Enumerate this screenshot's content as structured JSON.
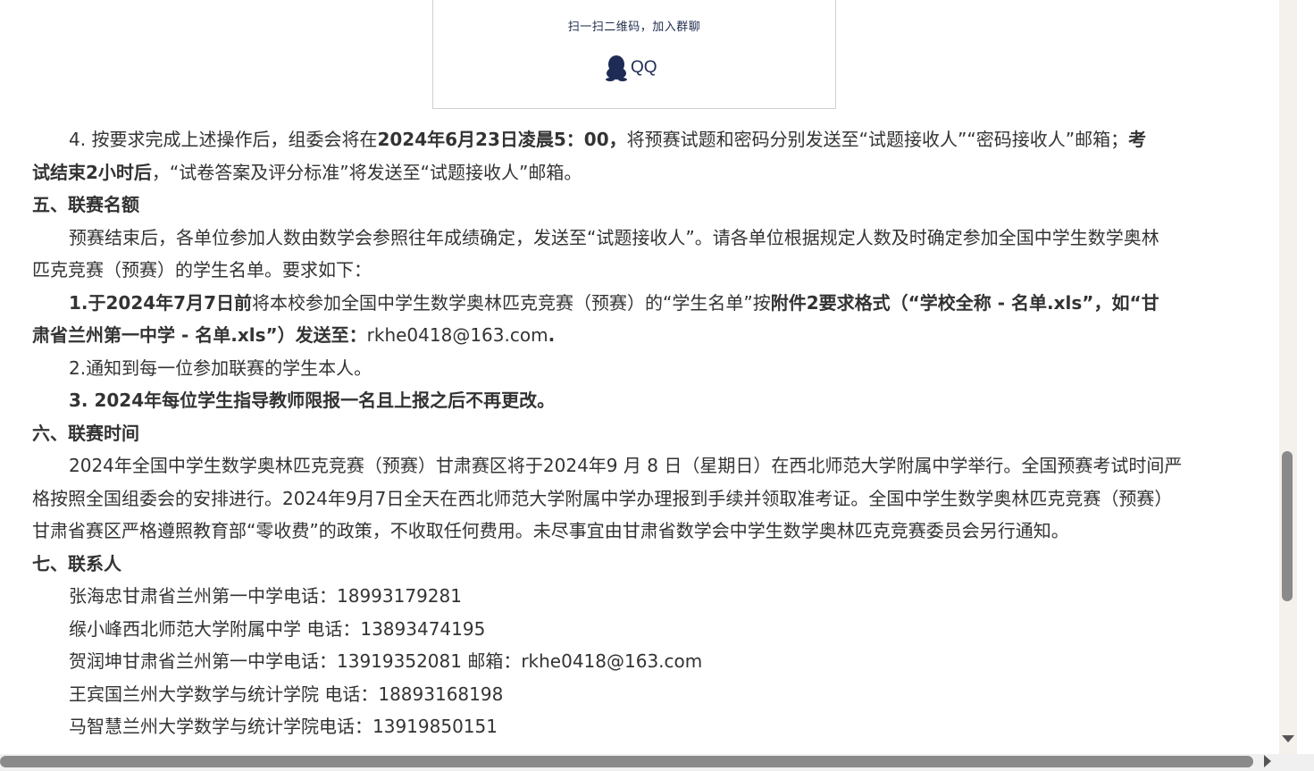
{
  "qr_card": {
    "caption": "扫一扫二维码，加入群聊",
    "qq_label": "QQ",
    "icon": "qq-penguin-icon"
  },
  "article": {
    "p1": {
      "a": "4. 按要求完成上述操作后，组委会将在",
      "b": "2024年6月23日凌晨5：00，",
      "c": "将预赛试题和密码分别发送至“试题接收人”“密码接收人”邮箱；",
      "d": "考",
      "e": "试结束2小时后",
      "f": "，“试卷答案及评分标准”将发送至“试题接收人”邮箱。"
    },
    "h5": "五、联赛名额",
    "p2_line1": "预赛结束后，各单位参加人数由数学会参照往年成绩确定，发送至“试题接收人”。请各单位根据规定人数及时确定参加全国中学生数学奥林",
    "p2_line2": "匹克竞赛（预赛）的学生名单。要求如下：",
    "p3": {
      "a": "1.于2024年7月7日前",
      "b": "将本校参加全国中学生数学奥林匹克竞赛（预赛）的“学生名单”按",
      "c": "附件2要求格式（“学校全称 - 名单.xls”，如“甘",
      "d": "肃省兰州第一中学 - 名单.xls”）发送至：",
      "e": "rkhe0418@163.com",
      "f": "."
    },
    "p4": "2.通知到每一位参加联赛的学生本人。",
    "p5": "3. 2024年每位学生指导教师限报一名且上报之后不再更改。",
    "h6": "六、联赛时间",
    "p6_line1": "2024年全国中学生数学奥林匹克竞赛（预赛）甘肃赛区将于2024年9 月 8 日（星期日）在西北师范大学附属中学举行。全国预赛考试时间严",
    "p6_line2": "格按照全国组委会的安排进行。2024年9月7日全天在西北师范大学附属中学办理报到手续并领取准考证。全国中学生数学奥林匹克竞赛（预赛）",
    "p6_line3": "甘肃省赛区严格遵照教育部“零收费”的政策，不收取任何费用。未尽事宜由甘肃省数学会中学生数学奥林匹克竞赛委员会另行通知。",
    "h7": "七、联系人",
    "contacts": [
      "张海忠甘肃省兰州第一中学电话：18993179281",
      "缑小峰西北师范大学附属中学 电话：13893474195",
      "贺润坤甘肃省兰州第一中学电话：13919352081 邮箱：rkhe0418@163.com",
      "王宾国兰州大学数学与统计学院 电话：18893168198",
      "马智慧兰州大学数学与统计学院电话：13919850151"
    ]
  },
  "colors": {
    "text": "#333333",
    "qr_caption": "#1f2d4d",
    "scrollbar_thumb": "#8a8a8a",
    "scrollbar_track": "#f4f0ec"
  }
}
